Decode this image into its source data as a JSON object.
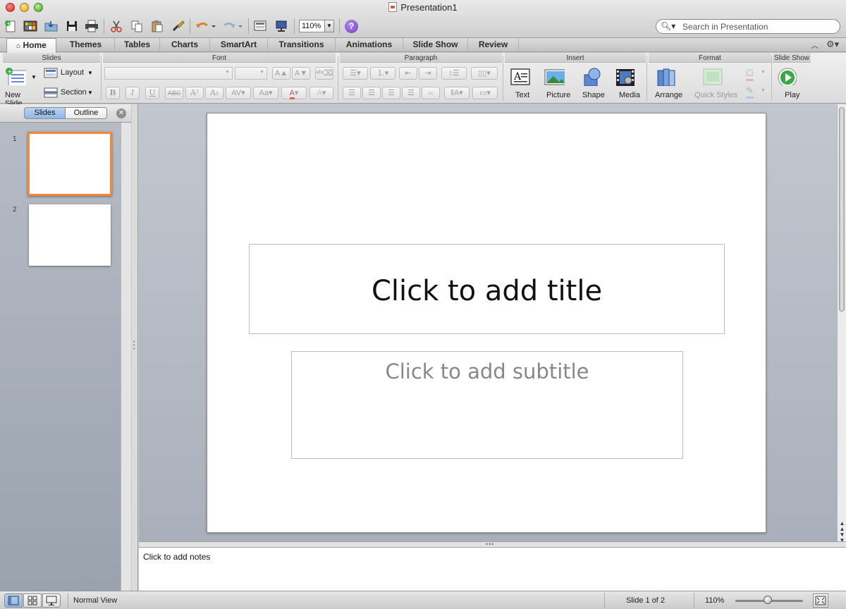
{
  "window": {
    "title": "Presentation1",
    "zoom": "110%",
    "search_placeholder": "Search in Presentation"
  },
  "tabs": [
    "Home",
    "Themes",
    "Tables",
    "Charts",
    "SmartArt",
    "Transitions",
    "Animations",
    "Slide Show",
    "Review"
  ],
  "ribbon": {
    "groups": {
      "slides": "Slides",
      "font": "Font",
      "paragraph": "Paragraph",
      "insert": "Insert",
      "format": "Format",
      "slideshow": "Slide Show"
    },
    "new_slide": "New Slide",
    "layout": "Layout",
    "section": "Section",
    "text": "Text",
    "picture": "Picture",
    "shape": "Shape",
    "media": "Media",
    "arrange": "Arrange",
    "quick_styles": "Quick Styles",
    "play": "Play",
    "font_buttons": [
      "B",
      "I",
      "U",
      "ABC",
      "A²",
      "A₂"
    ]
  },
  "left_panel": {
    "tab_slides": "Slides",
    "tab_outline": "Outline",
    "slide_numbers": [
      "1",
      "2"
    ]
  },
  "slide": {
    "title_placeholder": "Click to add title",
    "subtitle_placeholder": "Click to add subtitle"
  },
  "notes": {
    "placeholder": "Click to add notes"
  },
  "status": {
    "view_name": "Normal View",
    "slide_position": "Slide 1 of 2",
    "zoom": "110%"
  },
  "colors": {
    "selection_orange": "#f08a3a",
    "play_green": "#3aa845",
    "help_purple": "#6a3fc0"
  }
}
